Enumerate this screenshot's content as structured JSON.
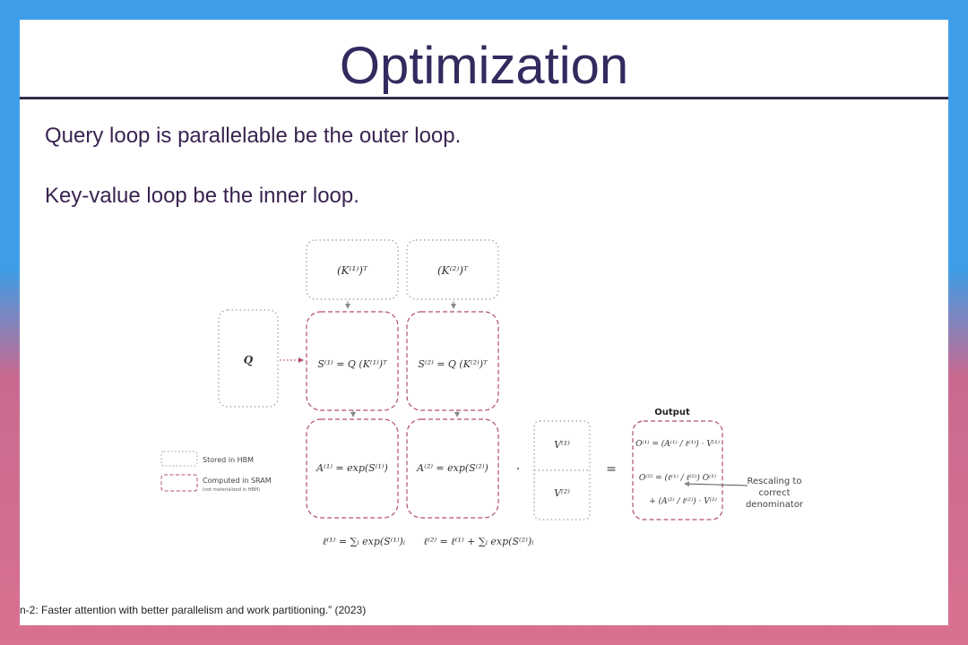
{
  "slide": {
    "title": "Optimization",
    "bullets": [
      "Query loop is parallelable be the outer loop.",
      "Key-value loop be the inner loop."
    ],
    "citation": "n-2: Faster attention with better parallelism and work partitioning.” (2023)"
  },
  "diagram": {
    "k1": "(K⁽¹⁾)ᵀ",
    "k2": "(K⁽²⁾)ᵀ",
    "q": "Q",
    "s1": "S⁽¹⁾ = Q (K⁽¹⁾)ᵀ",
    "s2": "S⁽²⁾ = Q (K⁽²⁾)ᵀ",
    "a1": "A⁽¹⁾ = exp(S⁽¹⁾)",
    "a2": "A⁽²⁾ = exp(S⁽²⁾)",
    "v1": "V⁽¹⁾",
    "v2": "V⁽²⁾",
    "dot": "·",
    "equals": "=",
    "output_title": "Output",
    "o1": "O⁽¹⁾ = (A⁽¹⁾ / ℓ⁽¹⁾) · V⁽¹⁾",
    "o2_line1": "O⁽²⁾ = (ℓ⁽¹⁾ / ℓ⁽²⁾) O⁽¹⁾",
    "o2_line2": "+ (A⁽²⁾ / ℓ⁽²⁾) · V⁽²⁾",
    "l1": "ℓ⁽¹⁾ = ∑ᵢ exp(S⁽¹⁾)ᵢ",
    "l2": "ℓ⁽²⁾ = ℓ⁽¹⁾ + ∑ᵢ exp(S⁽²⁾)ᵢ",
    "legend_hbm": "Stored in HBM",
    "legend_sram": "Computed in SRAM",
    "legend_sram_note": "(not materialized in HBM)",
    "rescale_line1": "Rescaling to",
    "rescale_line2": "correct",
    "rescale_line3": "denominator",
    "colors": {
      "sram_border": "#b0506a",
      "hbm_border": "#9a9a9a",
      "arrow": "#b0506a"
    }
  }
}
